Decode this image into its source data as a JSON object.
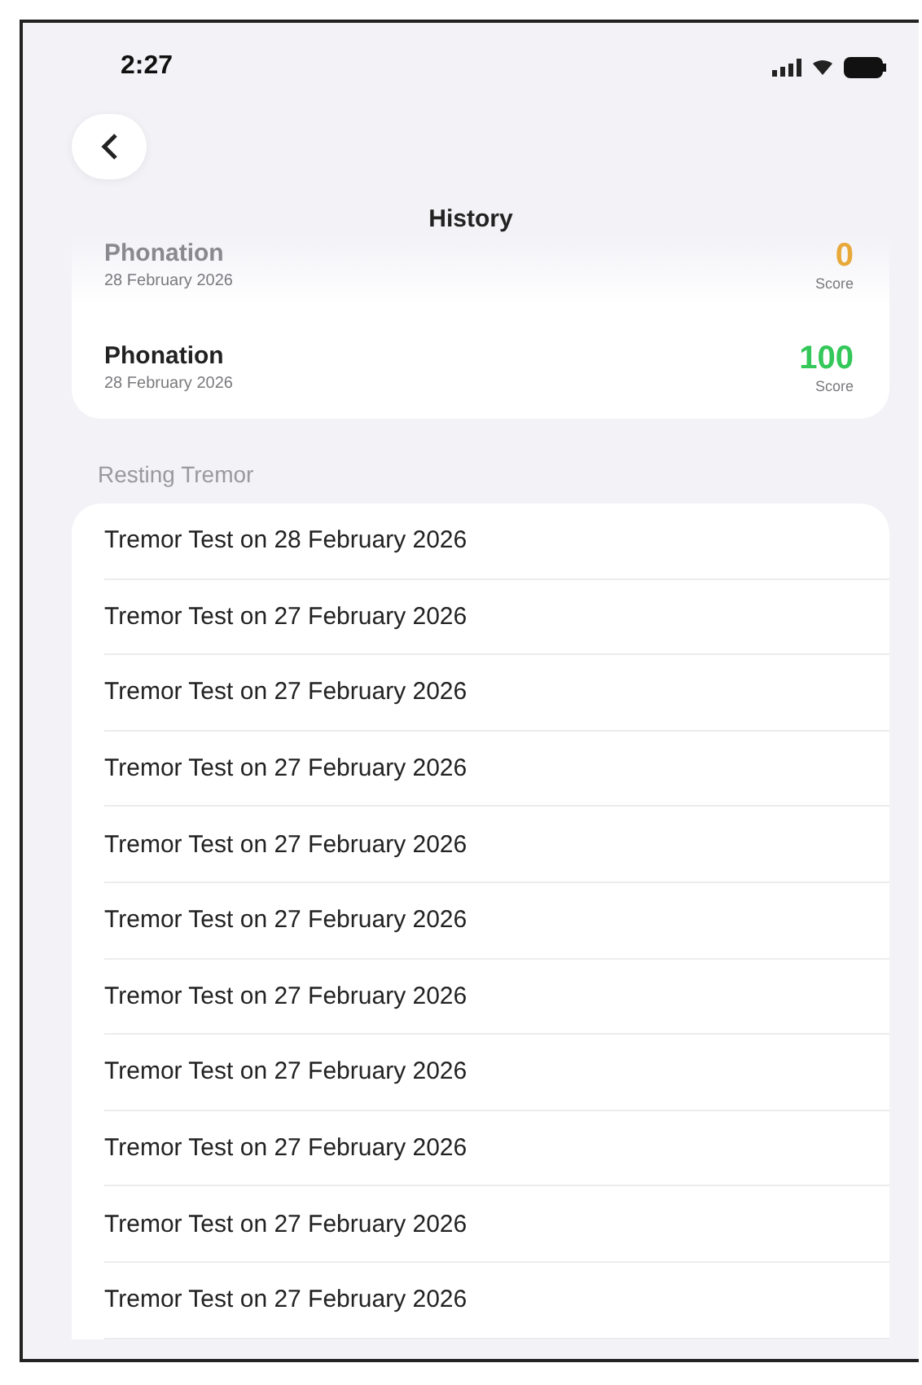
{
  "status_bar": {
    "time": "2:27"
  },
  "header": {
    "title": "History"
  },
  "phonation": [
    {
      "name": "Phonation",
      "date": "28 February 2026",
      "score": "0",
      "score_label": "Score",
      "color": "#e8a93a",
      "dimmed": true
    },
    {
      "name": "Phonation",
      "date": "28 February 2026",
      "score": "100",
      "score_label": "Score",
      "color": "#34c759",
      "dimmed": false
    }
  ],
  "resting_tremor": {
    "heading": "Resting Tremor",
    "items": [
      "Tremor Test on 28 February 2026",
      "Tremor Test on 27 February 2026",
      "Tremor Test on 27 February 2026",
      "Tremor Test on 27 February 2026",
      "Tremor Test on 27 February 2026",
      "Tremor Test on 27 February 2026",
      "Tremor Test on 27 February 2026",
      "Tremor Test on 27 February 2026",
      "Tremor Test on 27 February 2026",
      "Tremor Test on 27 February 2026",
      "Tremor Test on 27 February 2026"
    ]
  }
}
